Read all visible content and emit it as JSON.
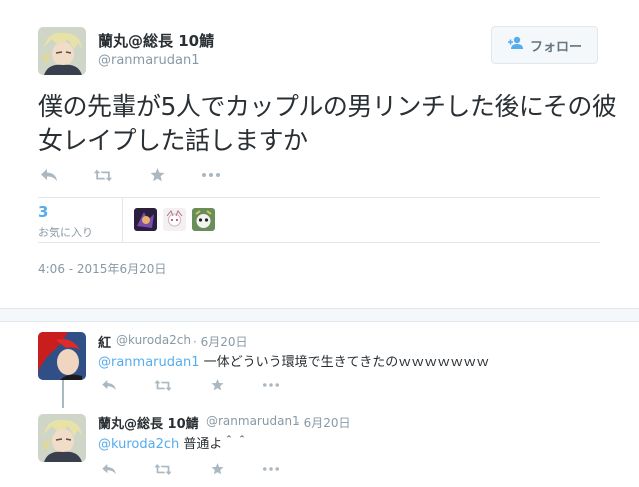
{
  "main": {
    "author_name": "蘭丸@総長 10鯖",
    "author_handle": "@ranmarudan1",
    "follow_label": "フォロー",
    "text": "僕の先輩が5人でカップルの男リンチした後にその彼女レイプした話しますか",
    "favorites_count": "3",
    "favorites_label": "お気に入り",
    "timestamp": "4:06 - 2015年6月20日"
  },
  "replies": [
    {
      "name": "紅",
      "handle": "@kuroda2ch",
      "date": "· 6月20日",
      "mention": "@ranmarudan1",
      "text": " 一体どういう環境で生きてきたのｗｗｗｗｗｗｗ"
    },
    {
      "name": "蘭丸@総長 10鯖",
      "handle": "@ranmarudan1",
      "date": "· 6月20日",
      "mention": "@kuroda2ch",
      "text": " 普通よ＾＾"
    }
  ],
  "colors": {
    "link": "#55acee",
    "muted": "#8899a6",
    "icon": "#aab8c2",
    "text": "#292f33"
  },
  "icons": [
    "reply-icon",
    "retweet-icon",
    "favorite-icon",
    "more-icon",
    "follow-person-icon"
  ]
}
